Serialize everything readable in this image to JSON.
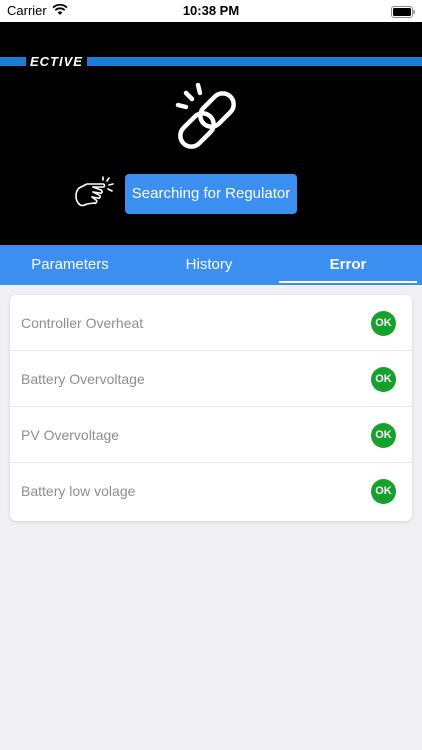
{
  "status_bar": {
    "carrier": "Carrier",
    "time": "10:38 PM"
  },
  "header": {
    "logo_text": "ECTIVE",
    "search_button_label": "Searching for Regulator",
    "brand_color": "#1a7fd4"
  },
  "tabs": [
    {
      "label": "Parameters",
      "active": false
    },
    {
      "label": "History",
      "active": false
    },
    {
      "label": "Error",
      "active": true
    }
  ],
  "errors": [
    {
      "label": "Controller Overheat",
      "status": "OK"
    },
    {
      "label": "Battery Overvoltage",
      "status": "OK"
    },
    {
      "label": "PV Overvoltage",
      "status": "OK"
    },
    {
      "label": "Battery low volage",
      "status": "OK"
    }
  ],
  "colors": {
    "accent": "#3a8ff0",
    "ok": "#16a12c"
  }
}
